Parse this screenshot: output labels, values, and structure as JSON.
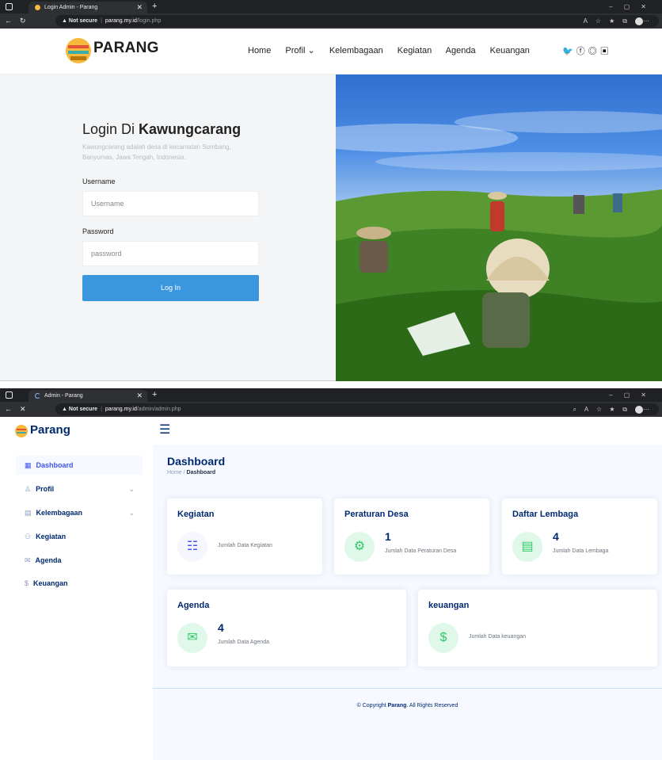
{
  "browser1": {
    "tab_title": "Login Admin - Parang",
    "url_warning": "Not secure",
    "url_host": "parang.my.id",
    "url_path": "/login.php"
  },
  "site": {
    "brand": "PARANG",
    "menu": [
      "Home",
      "Profil ⌄",
      "Kelembagaan",
      "Kegiatan",
      "Agenda",
      "Keuangan"
    ],
    "social_icons": [
      "twitter-icon",
      "facebook-icon",
      "instagram-icon",
      "linkedin-icon"
    ]
  },
  "login": {
    "heading_prefix": "Login Di ",
    "heading_strong": "Kawungcarang",
    "description": "Kawungcarang adalah desa di kecamatan Sumbang, Banyumas, Jawa Tengah, Indonesia.",
    "username_label": "Username",
    "username_placeholder": "Username",
    "password_label": "Password",
    "password_placeholder": "password",
    "button": "Log In"
  },
  "browser2": {
    "tab_title": "Admin - Parang",
    "url_warning": "Not secure",
    "url_host": "parang.my.id",
    "url_path": "/admin/admin.php"
  },
  "admin": {
    "brand": "Parang",
    "sidebar": [
      {
        "label": "Dashboard",
        "icon": "grid-icon",
        "active": true
      },
      {
        "label": "Profil",
        "icon": "person-icon",
        "chevron": true
      },
      {
        "label": "Kelembagaan",
        "icon": "document-icon",
        "chevron": true
      },
      {
        "label": "Kegiatan",
        "icon": "people-icon"
      },
      {
        "label": "Agenda",
        "icon": "envelope-icon"
      },
      {
        "label": "Keuangan",
        "icon": "dollar-icon"
      }
    ],
    "page_title": "Dashboard",
    "breadcrumb_home": "Home",
    "breadcrumb_sep": " / ",
    "breadcrumb_current": "Dashboard",
    "cards": {
      "kegiatan": {
        "title": "Kegiatan",
        "count": "",
        "label": "Jumlah Data Kegiatan"
      },
      "peraturan": {
        "title": "Peraturan Desa",
        "count": "1",
        "label": "Jumlah Data Peraturan Desa"
      },
      "lembaga": {
        "title": "Daftar Lembaga",
        "count": "4",
        "label": "Jumlah Data Lembaga"
      },
      "agenda": {
        "title": "Agenda",
        "count": "4",
        "label": "Jumlah Data Agenda"
      },
      "keuangan": {
        "title": "keuangan",
        "count": "",
        "label": "Jumlah Data keuangan"
      }
    },
    "footer_prefix": "© Copyright ",
    "footer_brand": "Parang",
    "footer_suffix": ". All Rights Reserved"
  },
  "colors": {
    "primary": "#012970",
    "accent": "#4154f1",
    "green": "#2eca6a",
    "login_button": "#3a96dd"
  }
}
